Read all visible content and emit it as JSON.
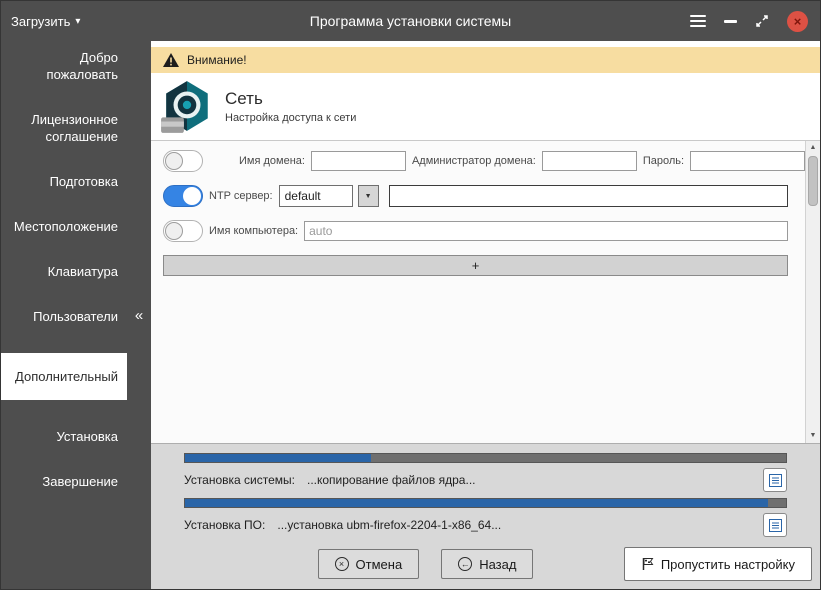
{
  "titlebar": {
    "load_label": "Загрузить",
    "title": "Программа установки системы"
  },
  "sidebar": {
    "items": [
      {
        "label": "Добро пожаловать"
      },
      {
        "label": "Лицензионное соглашение"
      },
      {
        "label": "Подготовка"
      },
      {
        "label": "Местоположение"
      },
      {
        "label": "Клавиатура"
      },
      {
        "label": "Пользователи"
      },
      {
        "label": "Дополнительный"
      },
      {
        "label": "Установка"
      },
      {
        "label": "Завершение"
      }
    ],
    "active_index": 6,
    "collapse_label": "«"
  },
  "content": {
    "warning_label": "Внимание!",
    "section_title": "Сеть",
    "section_subtitle": "Настройка доступа к сети",
    "form": {
      "domain_name_label": "Имя домена:",
      "domain_admin_label": "Администратор домена:",
      "password_label": "Пароль:",
      "ntp_label": "NTP сервер:",
      "ntp_selected": "default",
      "hostname_label": "Имя компьютера:",
      "hostname_placeholder": "auto",
      "add_button_label": "+"
    }
  },
  "progress": {
    "system_label": "Установка системы:",
    "system_status": "...копирование файлов ядра...",
    "system_percent": 31,
    "software_label": "Установка ПО:",
    "software_status": "...установка ubm-firefox-2204-1-x86_64...",
    "software_percent": 97
  },
  "footer": {
    "cancel_label": "Отмена",
    "back_label": "Назад",
    "skip_label": "Пропустить настройку"
  },
  "colors": {
    "chrome": "#4e4e4e",
    "warning_bg": "#f7dda1",
    "toggle_on": "#3584e4",
    "progress_fill": "#2a65a8",
    "close_button": "#dd5144"
  }
}
